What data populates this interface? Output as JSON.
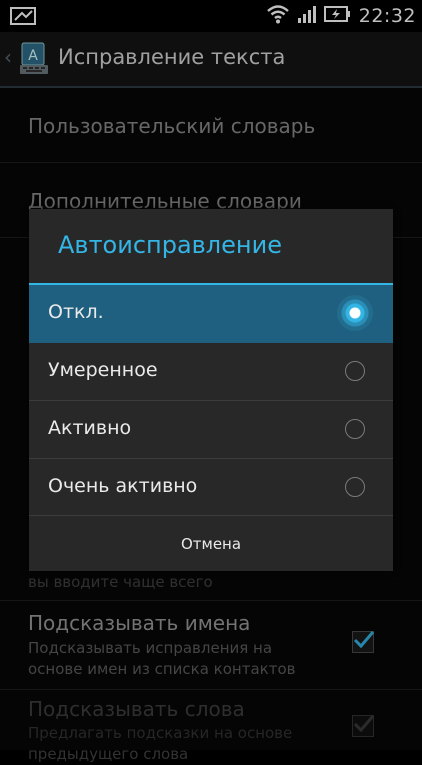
{
  "status_bar": {
    "time": "22:32",
    "icons": [
      "notification-icon",
      "wifi-icon",
      "signal-icon",
      "battery-charging-icon"
    ]
  },
  "action_bar": {
    "title": "Исправление текста",
    "icon": "keyboard-settings-icon"
  },
  "settings": {
    "user_dictionary": "Пользовательский словарь",
    "extra_dictionaries": "Дополнительные словари",
    "hidden_summary_tail": "вы вводите чаще всего",
    "suggest_names_title": "Подсказывать имена",
    "suggest_names_summary": "Подсказывать исправления на основе имен из списка контактов",
    "suggest_names_checked": true,
    "suggest_words_title": "Подсказывать слова",
    "suggest_words_summary": "Предлагать подсказки на основе предыдущего слова",
    "suggest_words_checked": true
  },
  "dialog": {
    "title": "Автоисправление",
    "options": [
      {
        "label": "Откл.",
        "selected": true
      },
      {
        "label": "Умеренное",
        "selected": false
      },
      {
        "label": "Активно",
        "selected": false
      },
      {
        "label": "Очень активно",
        "selected": false
      }
    ],
    "cancel_label": "Отмена"
  },
  "colors": {
    "accent": "#33b5e5",
    "selected_row": "#1f5f7f",
    "dialog_bg": "#282828"
  }
}
